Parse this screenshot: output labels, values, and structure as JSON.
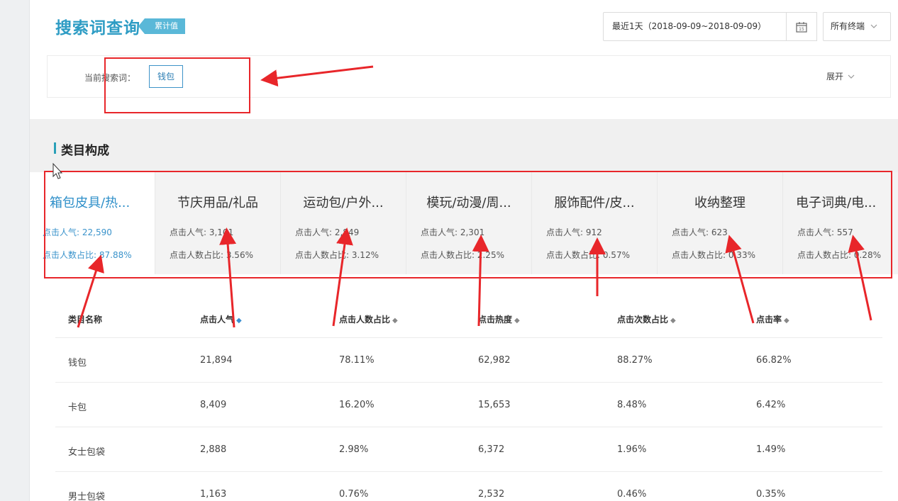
{
  "header": {
    "title": "搜索词查询",
    "tag": "累计值",
    "date_range": "最近1天（2018-09-09~2018-09-09）",
    "terminal": "所有终端"
  },
  "search": {
    "label": "当前搜索词：",
    "keyword": "钱包",
    "expand": "展开"
  },
  "section": {
    "title": "类目构成"
  },
  "categories": [
    {
      "name": "箱包皮具/热...",
      "clicks": "点击人气: 22,590",
      "share": "点击人数占比: 87.88%"
    },
    {
      "name": "节庆用品/礼品",
      "clicks": "点击人气: 3,101",
      "share": "点击人数占比: 3.56%"
    },
    {
      "name": "运动包/户外...",
      "clicks": "点击人气: 2,849",
      "share": "点击人数占比: 3.12%"
    },
    {
      "name": "模玩/动漫/周...",
      "clicks": "点击人气: 2,301",
      "share": "点击人数占比: 2.25%"
    },
    {
      "name": "服饰配件/皮...",
      "clicks": "点击人气: 912",
      "share": "点击人数占比: 0.57%"
    },
    {
      "name": "收纳整理",
      "clicks": "点击人气: 623",
      "share": "点击人数占比: 0.33%"
    },
    {
      "name": "电子词典/电...",
      "clicks": "点击人气: 557",
      "share": "点击人数占比: 0.28%"
    }
  ],
  "table": {
    "headers": [
      "类目名称",
      "点击人气",
      "点击人数占比",
      "点击热度",
      "点击次数占比",
      "点击率"
    ],
    "rows": [
      [
        "钱包",
        "21,894",
        "78.11%",
        "62,982",
        "88.27%",
        "66.82%"
      ],
      [
        "卡包",
        "8,409",
        "16.20%",
        "15,653",
        "8.48%",
        "6.42%"
      ],
      [
        "女士包袋",
        "2,888",
        "2.98%",
        "6,372",
        "1.96%",
        "1.49%"
      ],
      [
        "男士包袋",
        "1,163",
        "0.76%",
        "2,532",
        "0.46%",
        "0.35%"
      ]
    ]
  },
  "icons": {
    "sort": "sort-icon",
    "calendar": "calendar-icon",
    "chevron": "chevron-down-icon"
  },
  "colors": {
    "accent": "#2e8fc9",
    "annotation": "#e8262a"
  }
}
